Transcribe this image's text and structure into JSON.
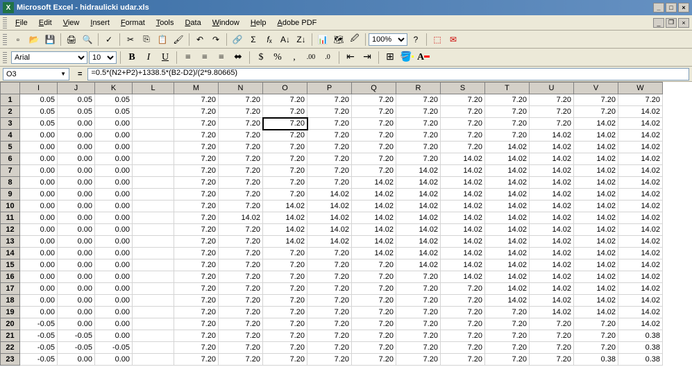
{
  "title": "Microsoft Excel - hidraulicki udar.xls",
  "titlebar_icon": "X",
  "menus": [
    "File",
    "Edit",
    "View",
    "Insert",
    "Format",
    "Tools",
    "Data",
    "Window",
    "Help",
    "Adobe PDF"
  ],
  "format_bar": {
    "font": "Arial",
    "size": "10"
  },
  "zoom": "100%",
  "name_box": "O3",
  "formula": "=0.5*(N2+P2)+1338.5*(B2-D2)/(2*9.80665)",
  "fx_symbol": "=",
  "columns": [
    "I",
    "J",
    "K",
    "L",
    "M",
    "N",
    "O",
    "P",
    "Q",
    "R",
    "S",
    "T",
    "U",
    "V",
    "W"
  ],
  "selected_cell": {
    "row": 3,
    "col": "O"
  },
  "active_row": 3,
  "chart_data": {
    "type": "table",
    "columns": [
      "I",
      "J",
      "K",
      "L",
      "M",
      "N",
      "O",
      "P",
      "Q",
      "R",
      "S",
      "T",
      "U",
      "V",
      "W"
    ],
    "rows": [
      {
        "n": 1,
        "I": "0.05",
        "J": "0.05",
        "K": "0.05",
        "L": "",
        "M": "7.20",
        "N": "7.20",
        "O": "7.20",
        "P": "7.20",
        "Q": "7.20",
        "R": "7.20",
        "S": "7.20",
        "T": "7.20",
        "U": "7.20",
        "V": "7.20",
        "W": "7.20"
      },
      {
        "n": 2,
        "I": "0.05",
        "J": "0.05",
        "K": "0.05",
        "L": "",
        "M": "7.20",
        "N": "7.20",
        "O": "7.20",
        "P": "7.20",
        "Q": "7.20",
        "R": "7.20",
        "S": "7.20",
        "T": "7.20",
        "U": "7.20",
        "V": "7.20",
        "W": "14.02"
      },
      {
        "n": 3,
        "I": "0.05",
        "J": "0.00",
        "K": "0.00",
        "L": "",
        "M": "7.20",
        "N": "7.20",
        "O": "7.20",
        "P": "7.20",
        "Q": "7.20",
        "R": "7.20",
        "S": "7.20",
        "T": "7.20",
        "U": "7.20",
        "V": "14.02",
        "W": "14.02"
      },
      {
        "n": 4,
        "I": "0.00",
        "J": "0.00",
        "K": "0.00",
        "L": "",
        "M": "7.20",
        "N": "7.20",
        "O": "7.20",
        "P": "7.20",
        "Q": "7.20",
        "R": "7.20",
        "S": "7.20",
        "T": "7.20",
        "U": "14.02",
        "V": "14.02",
        "W": "14.02"
      },
      {
        "n": 5,
        "I": "0.00",
        "J": "0.00",
        "K": "0.00",
        "L": "",
        "M": "7.20",
        "N": "7.20",
        "O": "7.20",
        "P": "7.20",
        "Q": "7.20",
        "R": "7.20",
        "S": "7.20",
        "T": "14.02",
        "U": "14.02",
        "V": "14.02",
        "W": "14.02"
      },
      {
        "n": 6,
        "I": "0.00",
        "J": "0.00",
        "K": "0.00",
        "L": "",
        "M": "7.20",
        "N": "7.20",
        "O": "7.20",
        "P": "7.20",
        "Q": "7.20",
        "R": "7.20",
        "S": "14.02",
        "T": "14.02",
        "U": "14.02",
        "V": "14.02",
        "W": "14.02"
      },
      {
        "n": 7,
        "I": "0.00",
        "J": "0.00",
        "K": "0.00",
        "L": "",
        "M": "7.20",
        "N": "7.20",
        "O": "7.20",
        "P": "7.20",
        "Q": "7.20",
        "R": "14.02",
        "S": "14.02",
        "T": "14.02",
        "U": "14.02",
        "V": "14.02",
        "W": "14.02"
      },
      {
        "n": 8,
        "I": "0.00",
        "J": "0.00",
        "K": "0.00",
        "L": "",
        "M": "7.20",
        "N": "7.20",
        "O": "7.20",
        "P": "7.20",
        "Q": "14.02",
        "R": "14.02",
        "S": "14.02",
        "T": "14.02",
        "U": "14.02",
        "V": "14.02",
        "W": "14.02"
      },
      {
        "n": 9,
        "I": "0.00",
        "J": "0.00",
        "K": "0.00",
        "L": "",
        "M": "7.20",
        "N": "7.20",
        "O": "7.20",
        "P": "14.02",
        "Q": "14.02",
        "R": "14.02",
        "S": "14.02",
        "T": "14.02",
        "U": "14.02",
        "V": "14.02",
        "W": "14.02"
      },
      {
        "n": 10,
        "I": "0.00",
        "J": "0.00",
        "K": "0.00",
        "L": "",
        "M": "7.20",
        "N": "7.20",
        "O": "14.02",
        "P": "14.02",
        "Q": "14.02",
        "R": "14.02",
        "S": "14.02",
        "T": "14.02",
        "U": "14.02",
        "V": "14.02",
        "W": "14.02"
      },
      {
        "n": 11,
        "I": "0.00",
        "J": "0.00",
        "K": "0.00",
        "L": "",
        "M": "7.20",
        "N": "14.02",
        "O": "14.02",
        "P": "14.02",
        "Q": "14.02",
        "R": "14.02",
        "S": "14.02",
        "T": "14.02",
        "U": "14.02",
        "V": "14.02",
        "W": "14.02"
      },
      {
        "n": 12,
        "I": "0.00",
        "J": "0.00",
        "K": "0.00",
        "L": "",
        "M": "7.20",
        "N": "7.20",
        "O": "14.02",
        "P": "14.02",
        "Q": "14.02",
        "R": "14.02",
        "S": "14.02",
        "T": "14.02",
        "U": "14.02",
        "V": "14.02",
        "W": "14.02"
      },
      {
        "n": 13,
        "I": "0.00",
        "J": "0.00",
        "K": "0.00",
        "L": "",
        "M": "7.20",
        "N": "7.20",
        "O": "14.02",
        "P": "14.02",
        "Q": "14.02",
        "R": "14.02",
        "S": "14.02",
        "T": "14.02",
        "U": "14.02",
        "V": "14.02",
        "W": "14.02"
      },
      {
        "n": 14,
        "I": "0.00",
        "J": "0.00",
        "K": "0.00",
        "L": "",
        "M": "7.20",
        "N": "7.20",
        "O": "7.20",
        "P": "7.20",
        "Q": "14.02",
        "R": "14.02",
        "S": "14.02",
        "T": "14.02",
        "U": "14.02",
        "V": "14.02",
        "W": "14.02"
      },
      {
        "n": 15,
        "I": "0.00",
        "J": "0.00",
        "K": "0.00",
        "L": "",
        "M": "7.20",
        "N": "7.20",
        "O": "7.20",
        "P": "7.20",
        "Q": "7.20",
        "R": "14.02",
        "S": "14.02",
        "T": "14.02",
        "U": "14.02",
        "V": "14.02",
        "W": "14.02"
      },
      {
        "n": 16,
        "I": "0.00",
        "J": "0.00",
        "K": "0.00",
        "L": "",
        "M": "7.20",
        "N": "7.20",
        "O": "7.20",
        "P": "7.20",
        "Q": "7.20",
        "R": "7.20",
        "S": "14.02",
        "T": "14.02",
        "U": "14.02",
        "V": "14.02",
        "W": "14.02"
      },
      {
        "n": 17,
        "I": "0.00",
        "J": "0.00",
        "K": "0.00",
        "L": "",
        "M": "7.20",
        "N": "7.20",
        "O": "7.20",
        "P": "7.20",
        "Q": "7.20",
        "R": "7.20",
        "S": "7.20",
        "T": "14.02",
        "U": "14.02",
        "V": "14.02",
        "W": "14.02"
      },
      {
        "n": 18,
        "I": "0.00",
        "J": "0.00",
        "K": "0.00",
        "L": "",
        "M": "7.20",
        "N": "7.20",
        "O": "7.20",
        "P": "7.20",
        "Q": "7.20",
        "R": "7.20",
        "S": "7.20",
        "T": "14.02",
        "U": "14.02",
        "V": "14.02",
        "W": "14.02"
      },
      {
        "n": 19,
        "I": "0.00",
        "J": "0.00",
        "K": "0.00",
        "L": "",
        "M": "7.20",
        "N": "7.20",
        "O": "7.20",
        "P": "7.20",
        "Q": "7.20",
        "R": "7.20",
        "S": "7.20",
        "T": "7.20",
        "U": "14.02",
        "V": "14.02",
        "W": "14.02"
      },
      {
        "n": 20,
        "I": "-0.05",
        "J": "0.00",
        "K": "0.00",
        "L": "",
        "M": "7.20",
        "N": "7.20",
        "O": "7.20",
        "P": "7.20",
        "Q": "7.20",
        "R": "7.20",
        "S": "7.20",
        "T": "7.20",
        "U": "7.20",
        "V": "7.20",
        "W": "14.02"
      },
      {
        "n": 21,
        "I": "-0.05",
        "J": "-0.05",
        "K": "0.00",
        "L": "",
        "M": "7.20",
        "N": "7.20",
        "O": "7.20",
        "P": "7.20",
        "Q": "7.20",
        "R": "7.20",
        "S": "7.20",
        "T": "7.20",
        "U": "7.20",
        "V": "7.20",
        "W": "0.38"
      },
      {
        "n": 22,
        "I": "-0.05",
        "J": "-0.05",
        "K": "-0.05",
        "L": "",
        "M": "7.20",
        "N": "7.20",
        "O": "7.20",
        "P": "7.20",
        "Q": "7.20",
        "R": "7.20",
        "S": "7.20",
        "T": "7.20",
        "U": "7.20",
        "V": "7.20",
        "W": "0.38"
      },
      {
        "n": 23,
        "I": "-0.05",
        "J": "0.00",
        "K": "0.00",
        "L": "",
        "M": "7.20",
        "N": "7.20",
        "O": "7.20",
        "P": "7.20",
        "Q": "7.20",
        "R": "7.20",
        "S": "7.20",
        "T": "7.20",
        "U": "7.20",
        "V": "0.38",
        "W": "0.38"
      }
    ]
  }
}
